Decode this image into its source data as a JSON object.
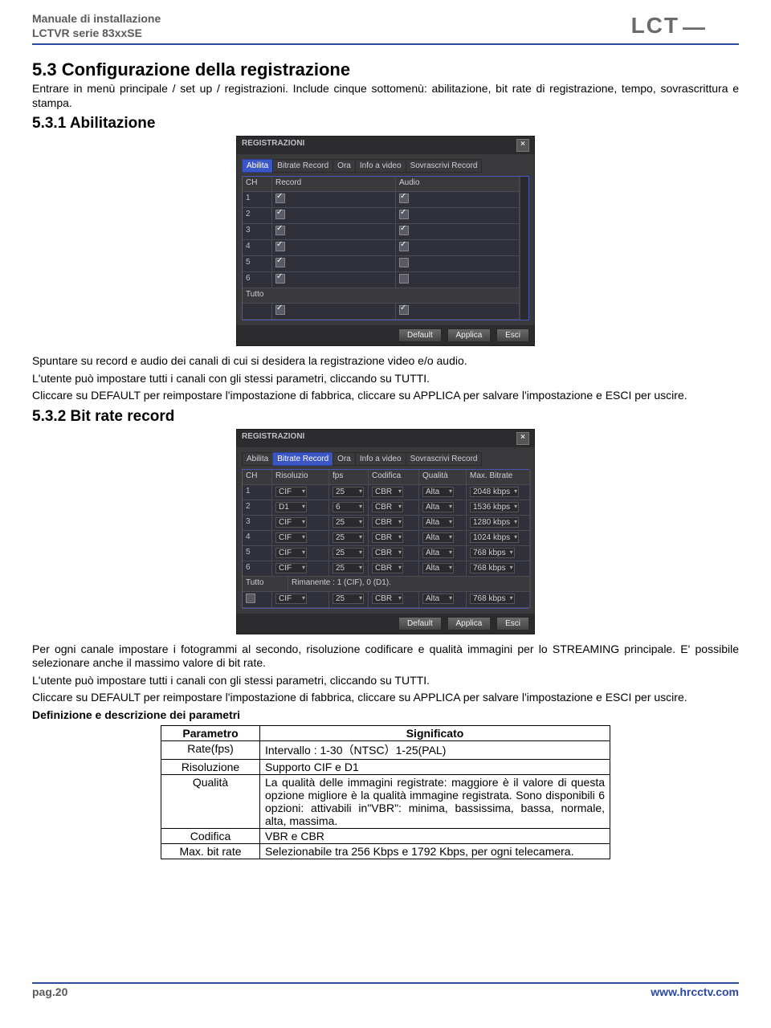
{
  "header": {
    "line1": "Manuale di installazione",
    "line2": "LCTVR serie 83xxSE",
    "logo": "LCT"
  },
  "s53": {
    "title": "5.3 Configurazione della registrazione",
    "p": "Entrare in menù principale / set up / registrazioni. Include cinque sottomenù: abilitazione, bit rate di registrazione, tempo, sovrascrittura e stampa."
  },
  "s531": {
    "title": "5.3.1 Abilitazione",
    "p1": "Spuntare su record e audio dei canali di cui si desidera la registrazione video e/o audio.",
    "p2": "L'utente può impostare tutti i canali con gli stessi parametri, cliccando su TUTTI.",
    "p3": "Cliccare su DEFAULT per reimpostare l'impostazione di fabbrica, cliccare su APPLICA per salvare l'impostazione e ESCI per uscire."
  },
  "dlg1": {
    "title": "REGISTRAZIONI",
    "tabs": [
      "Abilita",
      "Bitrate Record",
      "Ora",
      "Info a video",
      "Sovrascrivi Record"
    ],
    "cols": [
      "CH",
      "Record",
      "Audio"
    ],
    "rows": [
      {
        "ch": "1",
        "rec": true,
        "aud": true
      },
      {
        "ch": "2",
        "rec": true,
        "aud": true
      },
      {
        "ch": "3",
        "rec": true,
        "aud": true
      },
      {
        "ch": "4",
        "rec": true,
        "aud": true
      },
      {
        "ch": "5",
        "rec": true,
        "aud": false
      },
      {
        "ch": "6",
        "rec": true,
        "aud": false
      }
    ],
    "tutto": "Tutto",
    "allRec": true,
    "allAud": true,
    "btns": [
      "Default",
      "Applica",
      "Esci"
    ]
  },
  "s532": {
    "title": "5.3.2 Bit rate record",
    "p1": "Per ogni canale impostare i fotogrammi al secondo, risoluzione codificare e qualità immagini per lo STREAMING principale. E' possibile selezionare anche il massimo valore di bit rate.",
    "p2": "L'utente può impostare tutti i canali con gli stessi parametri, cliccando su TUTTI.",
    "p3": "Cliccare su DEFAULT per reimpostare l'impostazione di fabbrica, cliccare su APPLICA per salvare l'impostazione e ESCI per uscire.",
    "p4": "Definizione e descrizione dei parametri"
  },
  "dlg2": {
    "title": "REGISTRAZIONI",
    "tabs": [
      "Abilita",
      "Bitrate Record",
      "Ora",
      "Info a video",
      "Sovrascrivi Record"
    ],
    "cols": [
      "CH",
      "Risoluzio",
      "fps",
      "Codifica",
      "Qualità",
      "Max. Bitrate"
    ],
    "rows": [
      {
        "ch": "1",
        "res": "CIF",
        "fps": "25",
        "cod": "CBR",
        "q": "Alta",
        "mb": "2048 kbps"
      },
      {
        "ch": "2",
        "res": "D1",
        "fps": "6",
        "cod": "CBR",
        "q": "Alta",
        "mb": "1536 kbps"
      },
      {
        "ch": "3",
        "res": "CIF",
        "fps": "25",
        "cod": "CBR",
        "q": "Alta",
        "mb": "1280 kbps"
      },
      {
        "ch": "4",
        "res": "CIF",
        "fps": "25",
        "cod": "CBR",
        "q": "Alta",
        "mb": "1024 kbps"
      },
      {
        "ch": "5",
        "res": "CIF",
        "fps": "25",
        "cod": "CBR",
        "q": "Alta",
        "mb": "768 kbps"
      },
      {
        "ch": "6",
        "res": "CIF",
        "fps": "25",
        "cod": "CBR",
        "q": "Alta",
        "mb": "768 kbps"
      }
    ],
    "tutto": "Tutto",
    "remain": "Rimanente : 1 (CIF), 0 (D1).",
    "allRes": "CIF",
    "allFps": "25",
    "allCod": "CBR",
    "allQ": "Alta",
    "allMb": "768 kbps",
    "btns": [
      "Default",
      "Applica",
      "Esci"
    ]
  },
  "params": {
    "h1": "Parametro",
    "h2": "Significato",
    "rows": [
      {
        "p": "Rate(fps)",
        "s": "Intervallo : 1-30（NTSC）1-25(PAL)"
      },
      {
        "p": "Risoluzione",
        "s": "Supporto CIF e D1"
      },
      {
        "p": "Qualità",
        "s": "La qualità delle immagini registrate: maggiore è il valore di questa opzione migliore è la qualità immagine registrata. Sono disponibili 6 opzioni: attivabili in\"VBR\": minima, bassissima, bassa, normale, alta, massima."
      },
      {
        "p": "Codifica",
        "s": "VBR e CBR"
      },
      {
        "p": "Max. bit rate",
        "s": "Selezionabile tra 256 Kbps e 1792 Kbps, per ogni telecamera."
      }
    ]
  },
  "footer": {
    "page": "pag.20",
    "url": "www.hrcctv.com"
  }
}
